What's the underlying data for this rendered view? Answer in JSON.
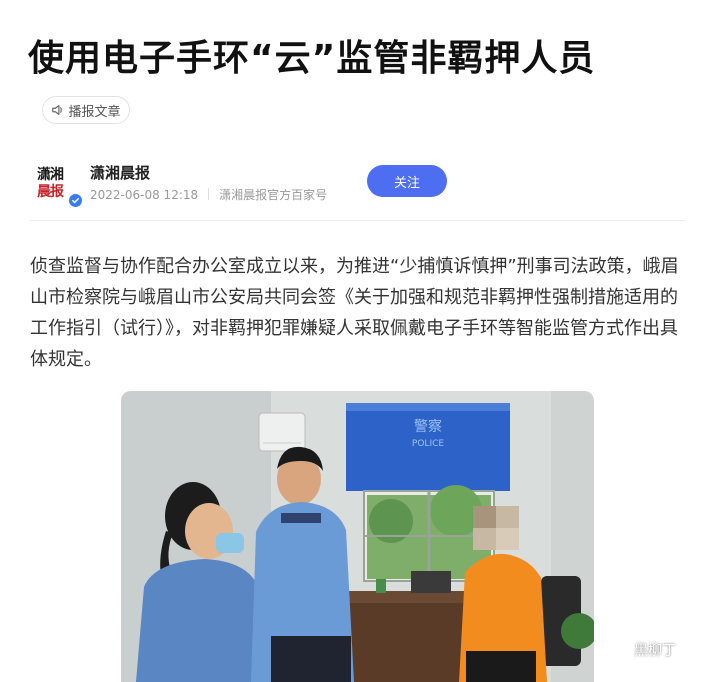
{
  "article": {
    "title": "使用电子手环“云”监管非羁押人员",
    "listen_label": "播报文章",
    "paragraph": "侦查监督与协作配合办公室成立以来，为推进“少捕慎诉慎押”刑事司法政策，峨眉山市检察院与峨眉山市公安局共同会签《关于加强和规范非羁押性强制措施适用的工作指引（试行）》，对非羁押犯罪嫌疑人采取佩戴电子手环等智能监管方式作出具体规定。"
  },
  "author": {
    "name": "潇湘晨报",
    "avatar_line1": "潇湘",
    "avatar_line2": "晨报",
    "date": "2022-06-08 12:18",
    "source": "潇湘晨报官方百家号",
    "follow_label": "关注"
  },
  "photo": {
    "sign_main": "警察",
    "sign_sub": "POLICE",
    "watermark": "黑柳丁"
  },
  "colors": {
    "accent": "#4e6ef2",
    "sign_blue": "#2d63c8",
    "shirt_orange": "#f28c1e",
    "uniform_blue": "#5b86c4"
  }
}
